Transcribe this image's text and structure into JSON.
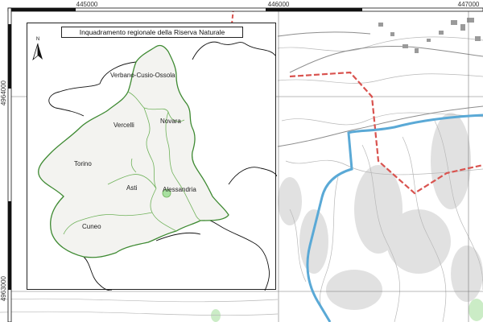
{
  "map": {
    "title": "Inquadramento regionale della Riserva Naturale",
    "north_symbol": "N",
    "easting_ticks": [
      "445000",
      "446000",
      "447000"
    ],
    "northing_ticks": [
      "4964000",
      "4963000"
    ],
    "provinces": {
      "vco": "Verbano-Cusio-Ossola",
      "vercelli": "Vercelli",
      "novara": "Novara",
      "torino": "Torino",
      "asti": "Asti",
      "alessandria": "Alessandria",
      "cuneo": "Cuneo"
    },
    "colors": {
      "region_border": "#3e8a32",
      "province_border": "#6fb25a",
      "region_fill": "#f3f3f0",
      "river": "#5aa9d6",
      "reserve_boundary": "#d9534f",
      "frame": "#111111"
    }
  }
}
